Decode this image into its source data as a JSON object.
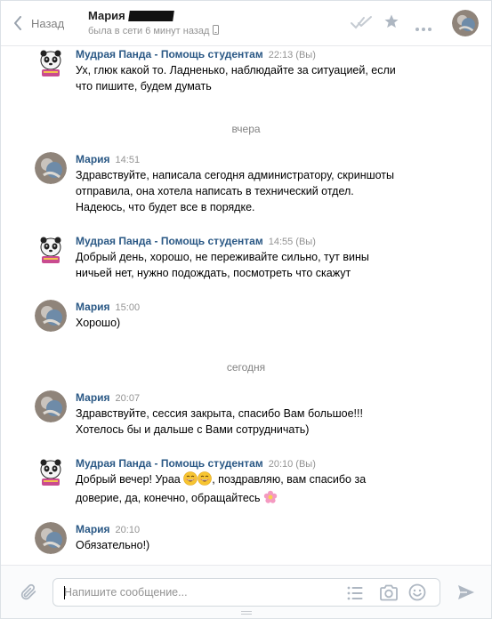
{
  "header": {
    "back_label": "Назад",
    "contact_name": "Мария",
    "status": "была в сети 6 минут назад"
  },
  "messages": [
    {
      "author": "Мудрая Панда - Помощь студентам",
      "time": "22:13 (Вы)",
      "text_lines": [
        "Ух, глюк какой то. Ладненько, наблюдайте за ситуацией, если",
        "что пишите, будем думать"
      ],
      "avatar": "panda-avatar"
    },
    {
      "author": "Мария",
      "time": "14:51",
      "text_lines": [
        "Здравствуйте, написала сегодня администратору, скриншоты",
        "отправила, она хотела написать в технический отдел.",
        "Надеюсь, что будет все в порядке."
      ],
      "avatar": "maria-avatar"
    },
    {
      "author": "Мудрая Панда - Помощь студентам",
      "time": "14:55 (Вы)",
      "text_lines": [
        "Добрый день, хорошо, не переживайте сильно, тут вины",
        "ничьей нет, нужно подождать, посмотреть что скажут"
      ],
      "avatar": "panda-avatar"
    },
    {
      "author": "Мария",
      "time": "15:00",
      "text_lines": [
        "Хорошо)"
      ],
      "avatar": "maria-avatar"
    },
    {
      "author": "Мария",
      "time": "20:07",
      "text_lines": [
        "Здравствуйте, сессия закрыта, спасибо Вам большое!!!",
        "Хотелось бы и дальше с Вами сотрудничать)"
      ],
      "avatar": "maria-avatar"
    },
    {
      "author": "Мудрая Панда - Помощь студентам",
      "time": "20:10 (Вы)",
      "text_lines": [
        "Добрый вечер! Ураа",
        ", поздравляю, вам спасибо за",
        "доверие, да, конечно, обращайтесь"
      ],
      "avatar": "panda-avatar"
    },
    {
      "author": "Мария",
      "time": "20:10",
      "text_lines": [
        "Обязательно!)"
      ],
      "avatar": "maria-avatar"
    }
  ],
  "date_separators": [
    "вчера",
    "сегодня"
  ],
  "composer": {
    "placeholder": "Напишите сообщение..."
  },
  "colors": {
    "author": "#2a5885",
    "time": "#939393",
    "icon": "#aeb7c2",
    "border": "#e7e8ec"
  }
}
